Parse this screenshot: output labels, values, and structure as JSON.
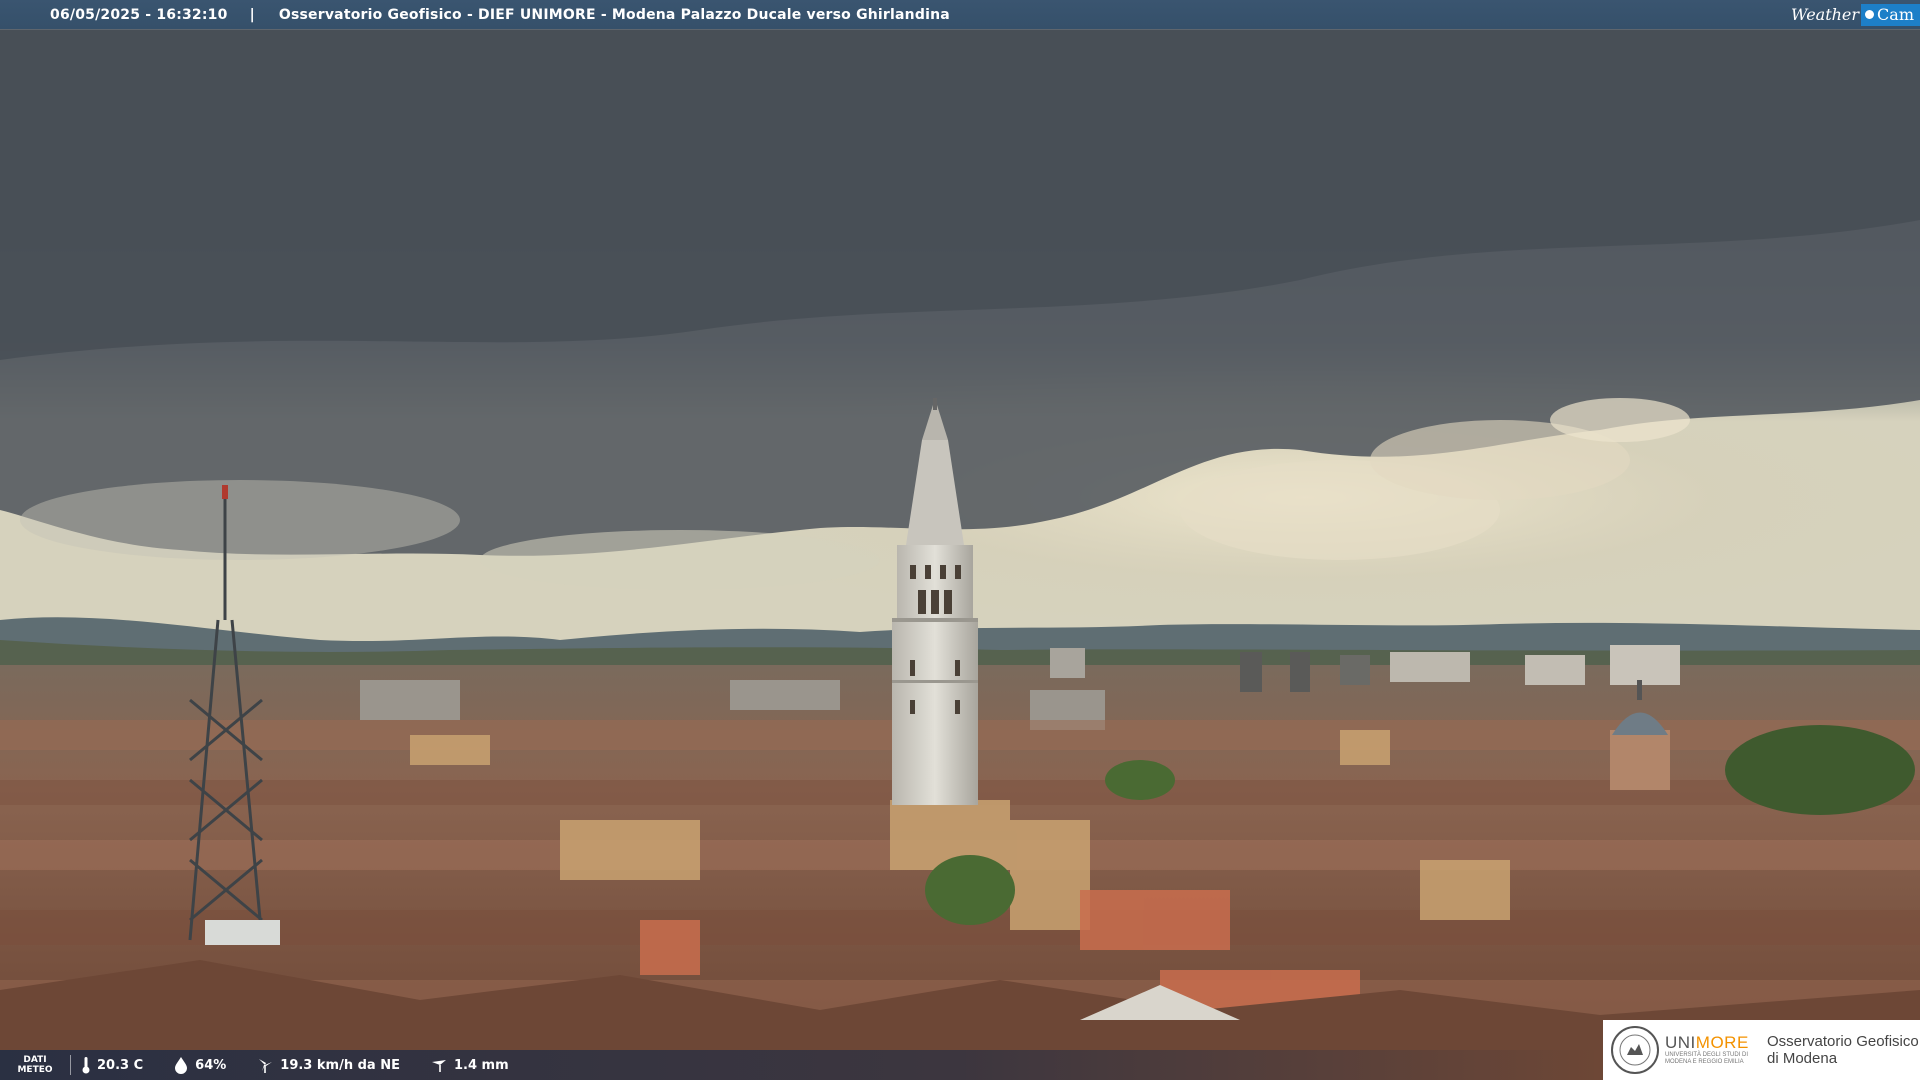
{
  "header": {
    "timestamp": "06/05/2025 - 16:32:10",
    "separator": "|",
    "title": "Osservatorio Geofisico - DIEF UNIMORE - Modena Palazzo Ducale verso Ghirlandina"
  },
  "brand": {
    "weather": "Weather",
    "cam": "Cam",
    "accent": "#1d7fc8"
  },
  "meteo": {
    "label_line1": "DATI",
    "label_line2": "METEO",
    "temperature": "20.3 C",
    "humidity": "64%",
    "wind": "19.3 km/h da NE",
    "rain": "1.4 mm"
  },
  "logo": {
    "uni_part1": "UNI",
    "uni_part2": "MORE",
    "uni_sub": "UNIVERSITÀ DEGLI STUDI DI MODENA E REGGIO EMILIA",
    "obs_line1": "Osservatorio Geofisico",
    "obs_line2": "di Modena",
    "accent": "#f39200"
  }
}
